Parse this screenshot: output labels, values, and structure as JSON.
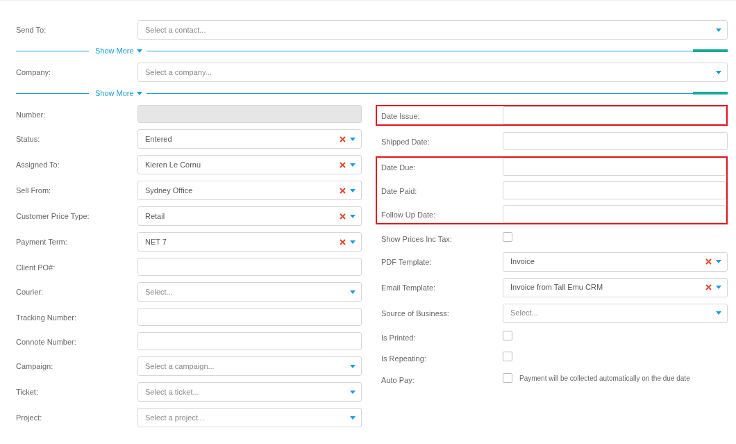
{
  "top_rows": [
    {
      "kind": "select",
      "label": "Send To:",
      "placeholder": "Select a contact..."
    },
    {
      "kind": "show_more",
      "label": "Show More"
    },
    {
      "kind": "select",
      "label": "Company:",
      "placeholder": "Select a company..."
    },
    {
      "kind": "show_more",
      "label": "Show More"
    }
  ],
  "left_fields": [
    {
      "kind": "text",
      "label": "Number:",
      "disabled": true
    },
    {
      "kind": "select",
      "label": "Status:",
      "value": "Entered"
    },
    {
      "kind": "select",
      "label": "Assigned To:",
      "value": "Kieren Le Cornu"
    },
    {
      "kind": "select",
      "label": "Sell From:",
      "value": "Sydney Office"
    },
    {
      "kind": "select",
      "label": "Customer Price Type:",
      "value": "Retail"
    },
    {
      "kind": "select",
      "label": "Payment Term:",
      "value": "NET 7"
    },
    {
      "kind": "text",
      "label": "Client PO#:",
      "disabled": false
    },
    {
      "kind": "select",
      "label": "Courier:",
      "placeholder": "Select..."
    },
    {
      "kind": "text",
      "label": "Tracking Number:",
      "disabled": false
    },
    {
      "kind": "text",
      "label": "Connote Number:",
      "disabled": false
    },
    {
      "kind": "select",
      "label": "Campaign:",
      "placeholder": "Select a campaign..."
    },
    {
      "kind": "select",
      "label": "Ticket:",
      "placeholder": "Select a ticket..."
    },
    {
      "kind": "select",
      "label": "Project:",
      "placeholder": "Select a project..."
    }
  ],
  "right_groups": [
    {
      "highlighted": true,
      "fields": [
        {
          "kind": "text",
          "label": "Date Issue:",
          "disabled": false
        }
      ]
    },
    {
      "highlighted": false,
      "fields": [
        {
          "kind": "text",
          "label": "Shipped Date:",
          "disabled": false
        }
      ]
    },
    {
      "highlighted": true,
      "fields": [
        {
          "kind": "text",
          "label": "Date Due:",
          "disabled": false
        },
        {
          "kind": "text",
          "label": "Date Paid:",
          "disabled": false
        },
        {
          "kind": "text",
          "label": "Follow Up Date:",
          "disabled": false
        }
      ]
    },
    {
      "highlighted": false,
      "fields": [
        {
          "kind": "checkbox",
          "label": "Show Prices Inc Tax:",
          "checked": false
        },
        {
          "kind": "select",
          "label": "PDF Template:",
          "value": "Invoice"
        },
        {
          "kind": "select",
          "label": "Email Template:",
          "value": "Invoice from Tall Emu CRM"
        },
        {
          "kind": "select",
          "label": "Source of Business:",
          "placeholder": "Select..."
        },
        {
          "kind": "checkbox",
          "label": "Is Printed:",
          "checked": false
        },
        {
          "kind": "checkbox",
          "label": "Is Repeating:",
          "checked": false
        },
        {
          "kind": "checkbox",
          "label": "Auto Pay:",
          "checked": false,
          "note": "Payment will be collected automatically on the due date"
        }
      ]
    }
  ]
}
